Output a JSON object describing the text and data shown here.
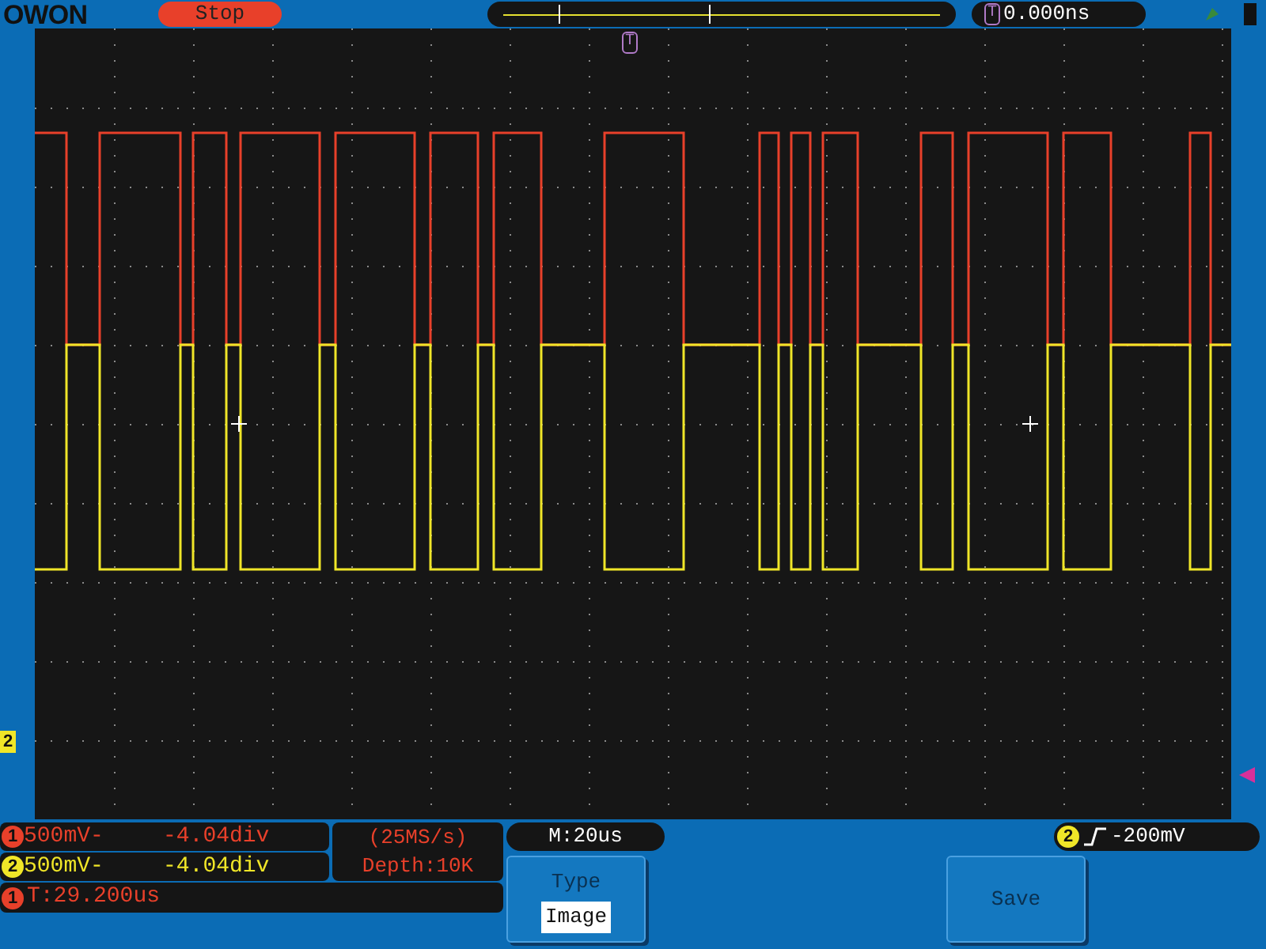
{
  "header": {
    "logo": "OWON",
    "run_state": "Stop",
    "trigger_offset": "0.000ns",
    "trigger_marker": "T"
  },
  "plot": {
    "trigger_marker": "T",
    "ground_marker": "2"
  },
  "channels": [
    {
      "number": "1",
      "scale": "500mV-",
      "offset": "-4.04div",
      "color": "#e8402a"
    },
    {
      "number": "2",
      "scale": "500mV-",
      "offset": "-4.04div",
      "color": "#f0e628"
    }
  ],
  "acquisition": {
    "sample_rate": "(25MS/s)",
    "depth": "Depth:10K"
  },
  "measurement": {
    "channel": "1",
    "text": "T:29.200us"
  },
  "timebase": "M:20us",
  "trigger": {
    "channel": "2",
    "level": "-200mV"
  },
  "menu": [
    {
      "kind": "option",
      "title": "Type",
      "value": "Image"
    },
    {
      "kind": "action",
      "title": "Save"
    }
  ]
}
